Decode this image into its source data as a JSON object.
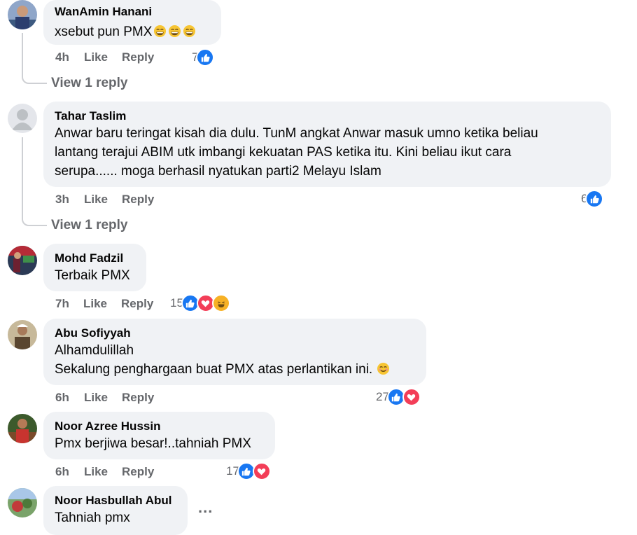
{
  "comments": [
    {
      "author": "WanAmin Hanani",
      "text": "xsebut pun PMX",
      "emojis": [
        "grin-emoji",
        "grin-emoji",
        "grin-emoji"
      ],
      "time": "4h",
      "like": "Like",
      "reply": "Reply",
      "reaction_count": "7",
      "reactions": [
        "like"
      ],
      "view_replies": "View 1 reply"
    },
    {
      "author": "Tahar Taslim",
      "text": "Anwar baru teringat kisah dia dulu. TunM angkat Anwar masuk umno ketika beliau\nlantang terajui ABIM utk imbangi kekuatan PAS ketika itu. Kini beliau ikut cara\nserupa...... moga berhasil nyatukan parti2 Melayu Islam",
      "time": "3h",
      "like": "Like",
      "reply": "Reply",
      "reaction_count": "6",
      "reactions": [
        "like"
      ],
      "view_replies": "View 1 reply"
    },
    {
      "author": "Mohd Fadzil",
      "text": "Terbaik PMX",
      "time": "7h",
      "like": "Like",
      "reply": "Reply",
      "reaction_count": "15",
      "reactions": [
        "like",
        "love",
        "haha"
      ]
    },
    {
      "author": "Abu Sofiyyah",
      "text": "Alhamdulillah\nSekalung penghargaan buat PMX atas perlantikan ini.",
      "emojis": [
        "smile-emoji"
      ],
      "time": "6h",
      "like": "Like",
      "reply": "Reply",
      "reaction_count": "27",
      "reactions": [
        "like",
        "love"
      ]
    },
    {
      "author": "Noor Azree Hussin",
      "text": "Pmx berjiwa besar!..tahniah PMX",
      "time": "6h",
      "like": "Like",
      "reply": "Reply",
      "reaction_count": "17",
      "reactions": [
        "like",
        "love"
      ]
    },
    {
      "author": "Noor Hasbullah Abul",
      "text": "Tahniah pmx",
      "more": "..."
    }
  ],
  "colors": {
    "bubble_bg": "#f0f2f5",
    "secondary_text": "#65676b",
    "like_blue": "#1877f2",
    "love_red": "#f33e58",
    "haha_yellow": "#f7b125"
  }
}
